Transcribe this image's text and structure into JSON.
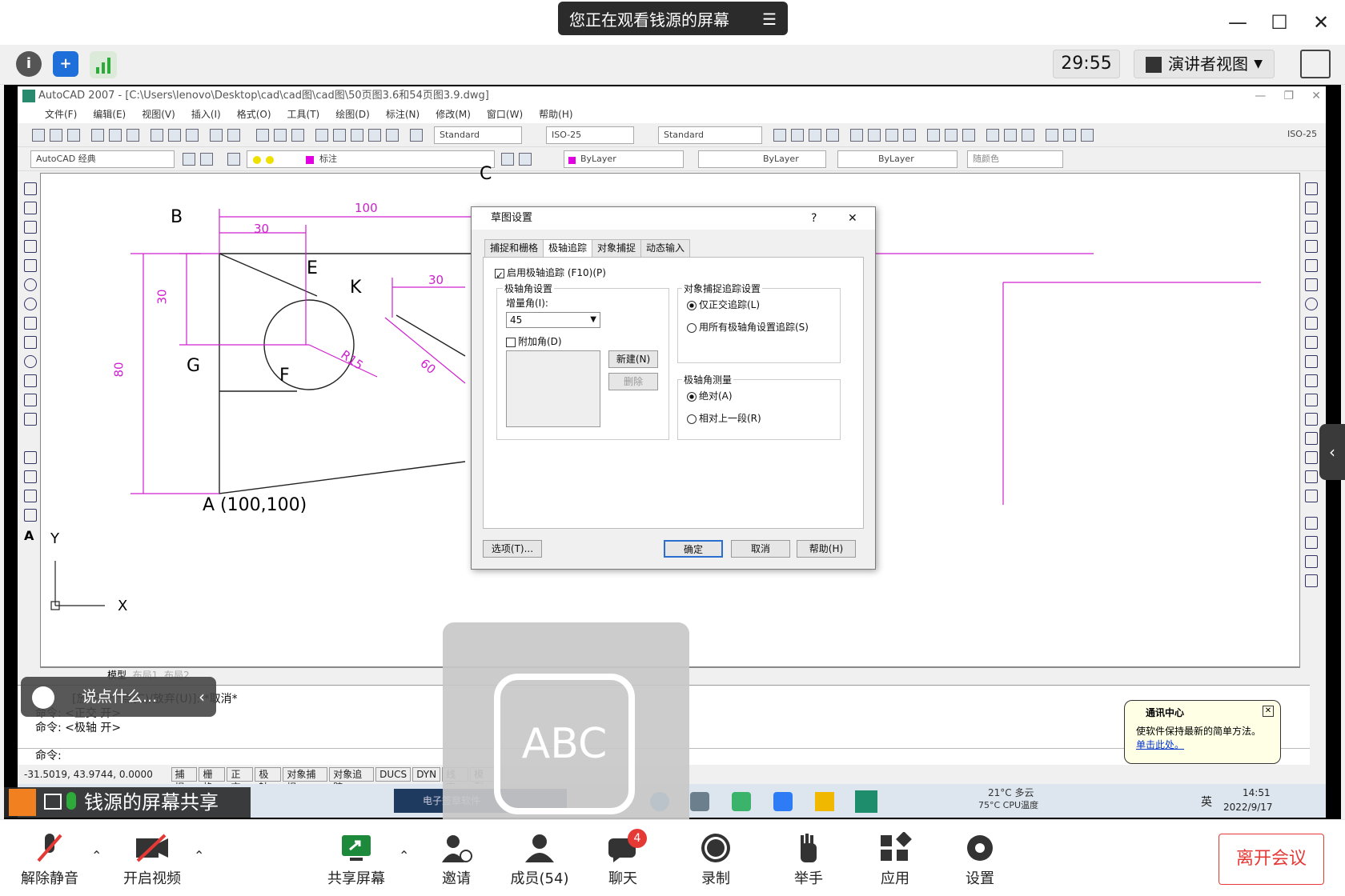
{
  "meeting": {
    "share_banner": "您正在观看钱源的屏幕",
    "timer": "29:55",
    "view_mode": "演讲者视图",
    "share_label": "钱源的屏幕共享",
    "chat_placeholder": "说点什么...",
    "bottom_buttons": [
      {
        "label": "解除静音",
        "icon": "mic-muted-icon"
      },
      {
        "label": "开启视频",
        "icon": "video-off-icon"
      },
      {
        "label": "共享屏幕",
        "icon": "share-screen-icon"
      },
      {
        "label": "邀请",
        "icon": "invite-icon"
      },
      {
        "label": "成员(54)",
        "icon": "members-icon"
      },
      {
        "label": "聊天",
        "icon": "chat-icon"
      },
      {
        "label": "录制",
        "icon": "record-icon"
      },
      {
        "label": "举手",
        "icon": "raise-hand-icon"
      },
      {
        "label": "应用",
        "icon": "apps-icon"
      },
      {
        "label": "设置",
        "icon": "settings-icon"
      }
    ],
    "chat_badge": "4",
    "leave_button": "离开会议"
  },
  "autocad": {
    "title": "AutoCAD 2007 - [C:\\Users\\lenovo\\Desktop\\cad\\cad图\\cad图\\50页图3.6和54页图3.9.dwg]",
    "menu": [
      "文件(F)",
      "编辑(E)",
      "视图(V)",
      "插入(I)",
      "格式(O)",
      "工具(T)",
      "绘图(D)",
      "标注(N)",
      "修改(M)",
      "窗口(W)",
      "帮助(H)"
    ],
    "text_style": "Standard",
    "dim_style": "ISO-25",
    "table_style": "Standard",
    "dim_style_right": "ISO-25",
    "workspace": "AutoCAD 经典",
    "layer": "标注",
    "color": "ByLayer",
    "linetype": "ByLayer",
    "lineweight": "ByLayer",
    "plot_style": "随颜色",
    "drawing_labels": {
      "c": "C",
      "b": "B",
      "e": "E",
      "k": "K",
      "g": "G",
      "f": "F",
      "a": "A (100,100)",
      "d100": "100",
      "d30a": "30",
      "d30b": "30",
      "d30c": "30",
      "d80": "80",
      "r15": "R15",
      "d60": "60",
      "axis_x": "X",
      "axis_y": "Y"
    },
    "layout_tabs": [
      "模型",
      "布局1",
      "布局2"
    ],
    "command_lines": [
      "[放下一个点(C)/放弃(U)]: *取消*",
      "命令:  <正交 开>",
      "命令:  <极轴 开>",
      "命令:"
    ],
    "coords": "-31.5019, 43.9744, 0.0000",
    "status_buttons": [
      "捕捉",
      "栅格",
      "正交",
      "极轴",
      "对象捕捉",
      "对象追踪",
      "DUCS",
      "DYN",
      "线宽",
      "模型"
    ]
  },
  "dialog": {
    "title": "草图设置",
    "help": "?",
    "tabs": [
      "捕捉和栅格",
      "极轴追踪",
      "对象捕捉",
      "动态输入"
    ],
    "enable_polar": "启用极轴追踪 (F10)(P)",
    "polar_group": "极轴角设置",
    "increment_label": "增量角(I):",
    "increment_value": "45",
    "additional_angle": "附加角(D)",
    "new_button": "新建(N)",
    "delete_button": "删除",
    "snap_group": "对象捕捉追踪设置",
    "snap_ortho": "仅正交追踪(L)",
    "snap_all": "用所有极轴角设置追踪(S)",
    "measure_group": "极轴角测量",
    "absolute": "绝对(A)",
    "relative": "相对上一段(R)",
    "options_button": "选项(T)...",
    "ok_button": "确定",
    "cancel_button": "取消",
    "help_button": "帮助(H)"
  },
  "notification": {
    "title": "通讯中心",
    "body": "使软件保持最新的简单方法。",
    "link": "单击此处。"
  },
  "taskbar": {
    "app_name": "电子签章软件",
    "weather": "21°C 多云",
    "cpu": "75°C CPU温度",
    "lang": "英",
    "time": "14:51",
    "date": "2022/9/17"
  },
  "colors": {
    "magenta": "#e000e0",
    "accent_red": "#e53935",
    "dim_line": "#d020d0"
  }
}
